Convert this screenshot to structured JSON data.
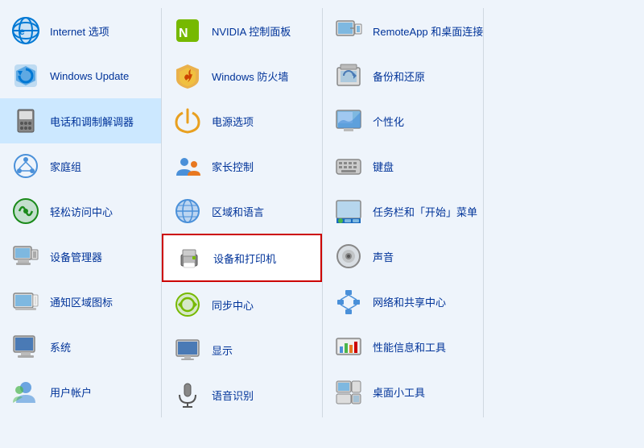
{
  "items": [
    {
      "id": "internet-options",
      "label": "Internet 选项",
      "icon": "ie",
      "col": 0,
      "row": 0
    },
    {
      "id": "windows-update",
      "label": "Windows Update",
      "icon": "windows-update",
      "col": 0,
      "row": 1
    },
    {
      "id": "phone-modem",
      "label": "电话和调制解调器",
      "icon": "phone-modem",
      "col": 0,
      "row": 2,
      "highlight": true
    },
    {
      "id": "homegroup",
      "label": "家庭组",
      "icon": "homegroup",
      "col": 0,
      "row": 3
    },
    {
      "id": "ease-access",
      "label": "轻松访问中心",
      "icon": "ease-access",
      "col": 0,
      "row": 4
    },
    {
      "id": "device-manager",
      "label": "设备管理器",
      "icon": "device-manager",
      "col": 0,
      "row": 5
    },
    {
      "id": "notification-icons",
      "label": "通知区域图标",
      "icon": "notification",
      "col": 0,
      "row": 6
    },
    {
      "id": "system",
      "label": "系统",
      "icon": "system",
      "col": 0,
      "row": 7
    },
    {
      "id": "user-accounts",
      "label": "用户帐户",
      "icon": "user-accounts",
      "col": 0,
      "row": 8
    },
    {
      "id": "nvidia-control",
      "label": "NVIDIA 控制面板",
      "icon": "nvidia",
      "col": 1,
      "row": 0
    },
    {
      "id": "windows-firewall",
      "label": "Windows 防火墙",
      "icon": "firewall",
      "col": 1,
      "row": 1
    },
    {
      "id": "power-options",
      "label": "电源选项",
      "icon": "power",
      "col": 1,
      "row": 2
    },
    {
      "id": "parental-controls",
      "label": "家长控制",
      "icon": "parental",
      "col": 1,
      "row": 3
    },
    {
      "id": "region-language",
      "label": "区域和语言",
      "icon": "region",
      "col": 1,
      "row": 4
    },
    {
      "id": "devices-printers",
      "label": "设备和打印机",
      "icon": "devices-printers",
      "col": 1,
      "row": 5,
      "outlined": true
    },
    {
      "id": "sync-center",
      "label": "同步中心",
      "icon": "sync",
      "col": 1,
      "row": 6
    },
    {
      "id": "display",
      "label": "显示",
      "icon": "display",
      "col": 1,
      "row": 7
    },
    {
      "id": "speech-recognition",
      "label": "语音识别",
      "icon": "speech",
      "col": 1,
      "row": 8
    },
    {
      "id": "remoteapp",
      "label": "RemoteApp 和桌面连接",
      "icon": "remoteapp",
      "col": 2,
      "row": 0
    },
    {
      "id": "backup-restore",
      "label": "备份和还原",
      "icon": "backup",
      "col": 2,
      "row": 1
    },
    {
      "id": "personalization",
      "label": "个性化",
      "icon": "personalization",
      "col": 2,
      "row": 2
    },
    {
      "id": "keyboard",
      "label": "键盘",
      "icon": "keyboard",
      "col": 2,
      "row": 3
    },
    {
      "id": "taskbar-start",
      "label": "任务栏和「开始」菜单",
      "icon": "taskbar",
      "col": 2,
      "row": 4
    },
    {
      "id": "sound",
      "label": "声音",
      "icon": "sound",
      "col": 2,
      "row": 5
    },
    {
      "id": "network-sharing",
      "label": "网络和共享中心",
      "icon": "network",
      "col": 2,
      "row": 6
    },
    {
      "id": "performance",
      "label": "性能信息和工具",
      "icon": "performance",
      "col": 2,
      "row": 7
    },
    {
      "id": "desktop-gadgets",
      "label": "桌面小工具",
      "icon": "gadgets",
      "col": 2,
      "row": 8
    },
    {
      "id": "col3-r0",
      "label": "",
      "icon": "",
      "col": 3,
      "row": 0
    },
    {
      "id": "col3-r1",
      "label": "",
      "icon": "",
      "col": 3,
      "row": 1
    },
    {
      "id": "col3-r2",
      "label": "",
      "icon": "",
      "col": 3,
      "row": 2
    },
    {
      "id": "col3-r3",
      "label": "",
      "icon": "",
      "col": 3,
      "row": 3
    },
    {
      "id": "col3-r4",
      "label": "",
      "icon": "",
      "col": 3,
      "row": 4
    },
    {
      "id": "col3-r5",
      "label": "",
      "icon": "",
      "col": 3,
      "row": 5
    },
    {
      "id": "col3-r6",
      "label": "",
      "icon": "",
      "col": 3,
      "row": 6
    }
  ]
}
